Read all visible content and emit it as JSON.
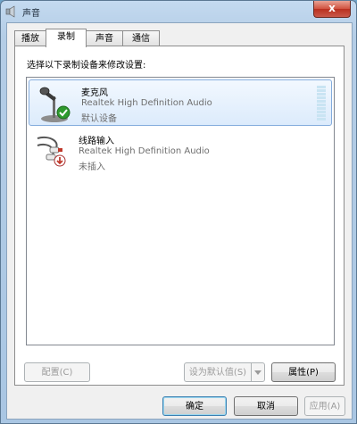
{
  "window": {
    "title": "声音",
    "close_label": "x"
  },
  "tabs": [
    {
      "label": "播放",
      "active": false
    },
    {
      "label": "录制",
      "active": true
    },
    {
      "label": "声音",
      "active": false
    },
    {
      "label": "通信",
      "active": false
    }
  ],
  "instruction": "选择以下录制设备来修改设置:",
  "devices": [
    {
      "name": "麦克风",
      "driver": "Realtek High Definition Audio",
      "status": "默认设备",
      "selected": true,
      "icon": "microphone-icon",
      "badge": "default-check-icon"
    },
    {
      "name": "线路输入",
      "driver": "Realtek High Definition Audio",
      "status": "未插入",
      "selected": false,
      "icon": "line-in-cable-icon",
      "badge": "unplugged-icon"
    }
  ],
  "pane_buttons": {
    "configure": "配置(C)",
    "set_default": "设为默认值(S)",
    "properties": "属性(P)"
  },
  "dialog_buttons": {
    "ok": "确定",
    "cancel": "取消",
    "apply": "应用(A)"
  },
  "colors": {
    "selection_border": "#84acdd",
    "check_green": "#2e9a2e",
    "unplugged_red": "#c0392b"
  }
}
